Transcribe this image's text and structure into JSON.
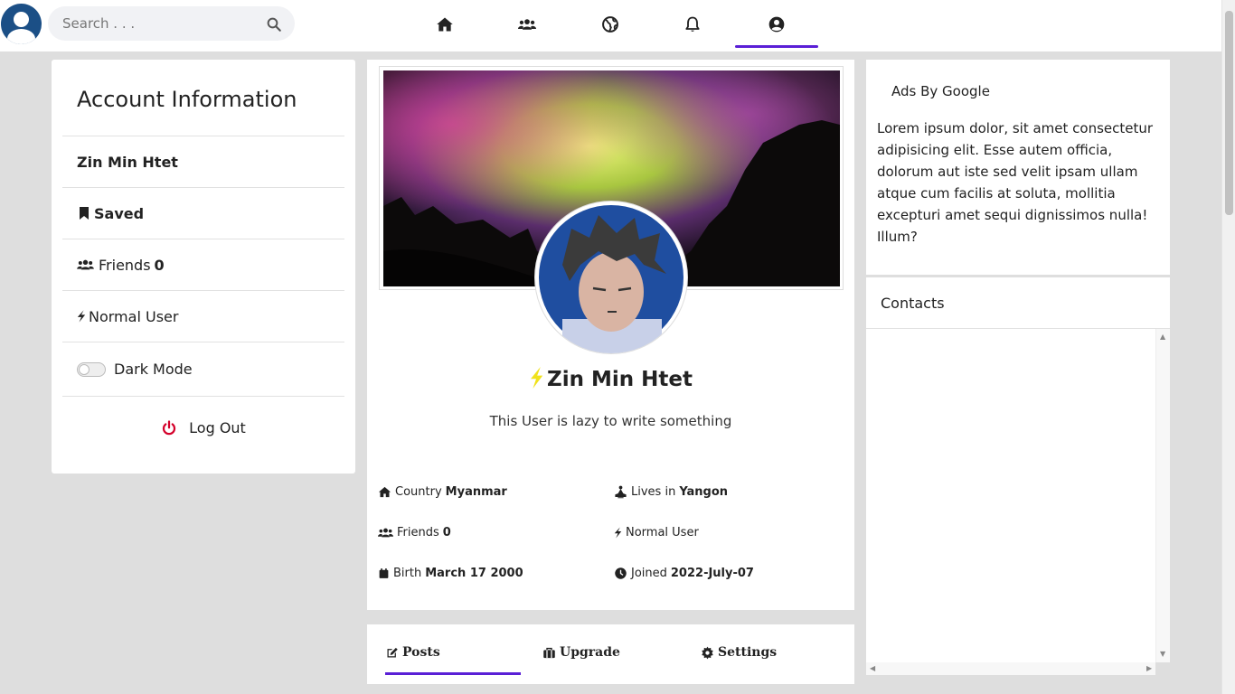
{
  "search": {
    "placeholder": "Search . . ."
  },
  "nav": {
    "icons": [
      "home-icon",
      "users-icon",
      "globe-icon",
      "bell-icon",
      "user-circle-icon"
    ],
    "active": "user-circle-icon",
    "accent_color": "#5a1fd6"
  },
  "account": {
    "title": "Account Information",
    "username": "Zin Min Htet",
    "saved_label": "Saved",
    "friends_label": "Friends",
    "friends_count": "0",
    "user_type": "Normal User",
    "dark_mode_label": "Dark Mode",
    "dark_mode_on": false,
    "logout_label": "Log Out"
  },
  "profile": {
    "name": "Zin Min Htet",
    "bio": "This User is lazy to write something",
    "country_label": "Country",
    "country": "Myanmar",
    "lives_label": "Lives in",
    "lives": "Yangon",
    "friends_label": "Friends",
    "friends_count": "0",
    "user_type": "Normal User",
    "birth_label": "Birth",
    "birth": "March 17 2000",
    "joined_label": "Joined",
    "joined": "2022-July-07"
  },
  "tabs": [
    {
      "label": "Posts",
      "icon": "edit-icon",
      "active": true
    },
    {
      "label": "Upgrade",
      "icon": "briefcase-icon",
      "active": false
    },
    {
      "label": "Settings",
      "icon": "gear-icon",
      "active": false
    }
  ],
  "ads": {
    "title": "Ads By Google",
    "text": "Lorem ipsum dolor, sit amet consectetur adipisicing elit. Esse autem officia, dolorum aut iste sed velit ipsam ullam atque cum facilis at soluta, mollitia excepturi amet sequi dignissimos nulla! Illum?"
  },
  "contacts": {
    "title": "Contacts"
  }
}
